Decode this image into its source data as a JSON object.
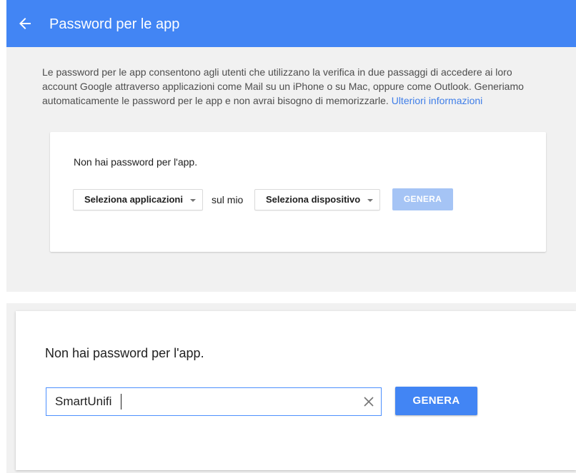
{
  "colors": {
    "appbar": "#4285f4",
    "link": "#3f7ee8",
    "button_primary": "#4285f4",
    "button_disabled": "#a5c4f5",
    "input_focus": "#4d90fe"
  },
  "appbar": {
    "back_icon": "arrow-left-icon",
    "title": "Password per le app"
  },
  "intro": {
    "text": "Le password per le app consentono agli utenti che utilizzano la verifica in due passaggi di accedere ai loro account Google attraverso applicazioni come Mail su un iPhone o su Mac, oppure come Outlook. Generiamo automaticamente le password per le app e non avrai bisogno di memorizzarle.",
    "link_label": "Ulteriori informazioni"
  },
  "card_small": {
    "empty_text": "Non hai password per l'app.",
    "app_select": {
      "selected": "Seleziona applicazioni"
    },
    "connector": "sul mio",
    "device_select": {
      "selected": "Seleziona dispositivo"
    },
    "generate_label": "GENERA"
  },
  "card_big": {
    "empty_text": "Non hai password per l'app.",
    "name_input": {
      "value": "SmartUnifi"
    },
    "clear_icon": "close-icon",
    "generate_label": "GENERA"
  }
}
